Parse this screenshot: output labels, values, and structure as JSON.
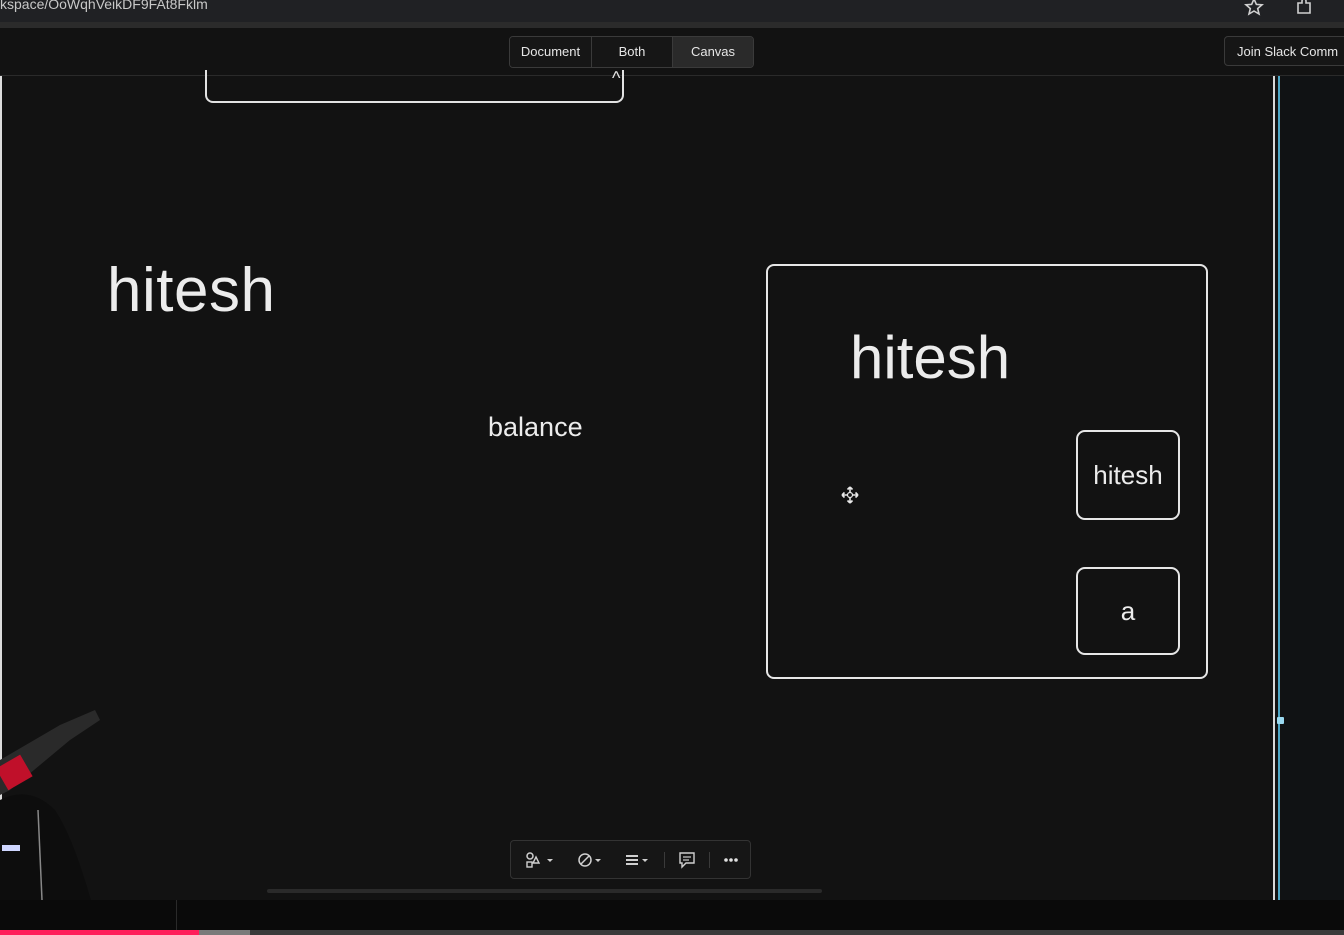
{
  "browser": {
    "url": "kspace/OoWqhVeikDF9FAt8Fklm"
  },
  "toolbar": {
    "view_modes": [
      "Document",
      "Both",
      "Canvas"
    ],
    "selected_view": "Canvas",
    "slack_button": "Join Slack Comm"
  },
  "canvas": {
    "big_text": "hitesh",
    "balance_text": "balance",
    "frame_title": "hitesh",
    "frame_button_1": "hitesh",
    "frame_button_2": "a"
  },
  "bottom_toolbar": {
    "icons": [
      "shapes-icon",
      "no-fill-icon",
      "stroke-lines-icon",
      "comment-icon",
      "more-icon"
    ]
  },
  "video": {
    "progress_fraction": 0.148,
    "buffered_fraction": 0.186
  },
  "colors": {
    "background": "#121212",
    "stroke": "#e6e6e6",
    "progress_played": "#ff1e5a",
    "guide_line": "#4da6c6"
  }
}
